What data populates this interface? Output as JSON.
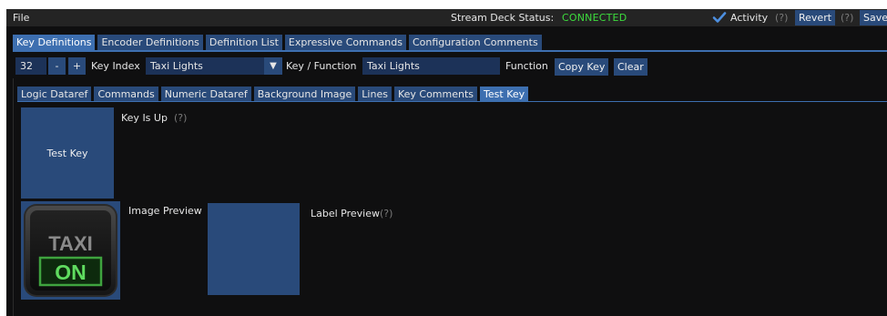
{
  "menubar": {
    "file_label": "File",
    "status_label": "Stream Deck Status:",
    "status_value": "CONNECTED",
    "activity_label": "Activity",
    "activity_help": "(?)",
    "revert_label": "Revert",
    "revert_help": "(?)",
    "save_label": "Save"
  },
  "main_tabs": [
    {
      "label": "Key Definitions",
      "active": true
    },
    {
      "label": "Encoder Definitions",
      "active": false
    },
    {
      "label": "Definition List",
      "active": false
    },
    {
      "label": "Expressive Commands",
      "active": false
    },
    {
      "label": "Configuration Comments",
      "active": false
    }
  ],
  "key_row": {
    "key_number": "32",
    "minus_label": "-",
    "plus_label": "+",
    "key_index_label": "Key Index",
    "key_index_value": "Taxi Lights",
    "combo_arrow": "▼",
    "key_function_label": "Key / Function",
    "key_function_value": "Taxi Lights",
    "function_label": "Function",
    "copy_key_label": "Copy Key",
    "clear_label": "Clear"
  },
  "sub_tabs": [
    {
      "label": "Logic Dataref",
      "active": false
    },
    {
      "label": "Commands",
      "active": false
    },
    {
      "label": "Numeric Dataref",
      "active": false
    },
    {
      "label": "Background Image",
      "active": false
    },
    {
      "label": "Lines",
      "active": false
    },
    {
      "label": "Key Comments",
      "active": false
    },
    {
      "label": "Test Key",
      "active": true
    }
  ],
  "test_key": {
    "button_label": "Test Key",
    "state_label": "Key Is Up",
    "state_help": "(?)"
  },
  "preview": {
    "image_preview_label": "Image Preview",
    "label_preview_label": "Label Preview",
    "label_preview_help": "(?)",
    "key_image_top_text": "TAXI",
    "key_image_bottom_text": "ON"
  },
  "colors": {
    "accent": "#3d6fb0",
    "button": "#294a7a",
    "connected": "#3ddc3d",
    "background": "#0f0f10"
  }
}
